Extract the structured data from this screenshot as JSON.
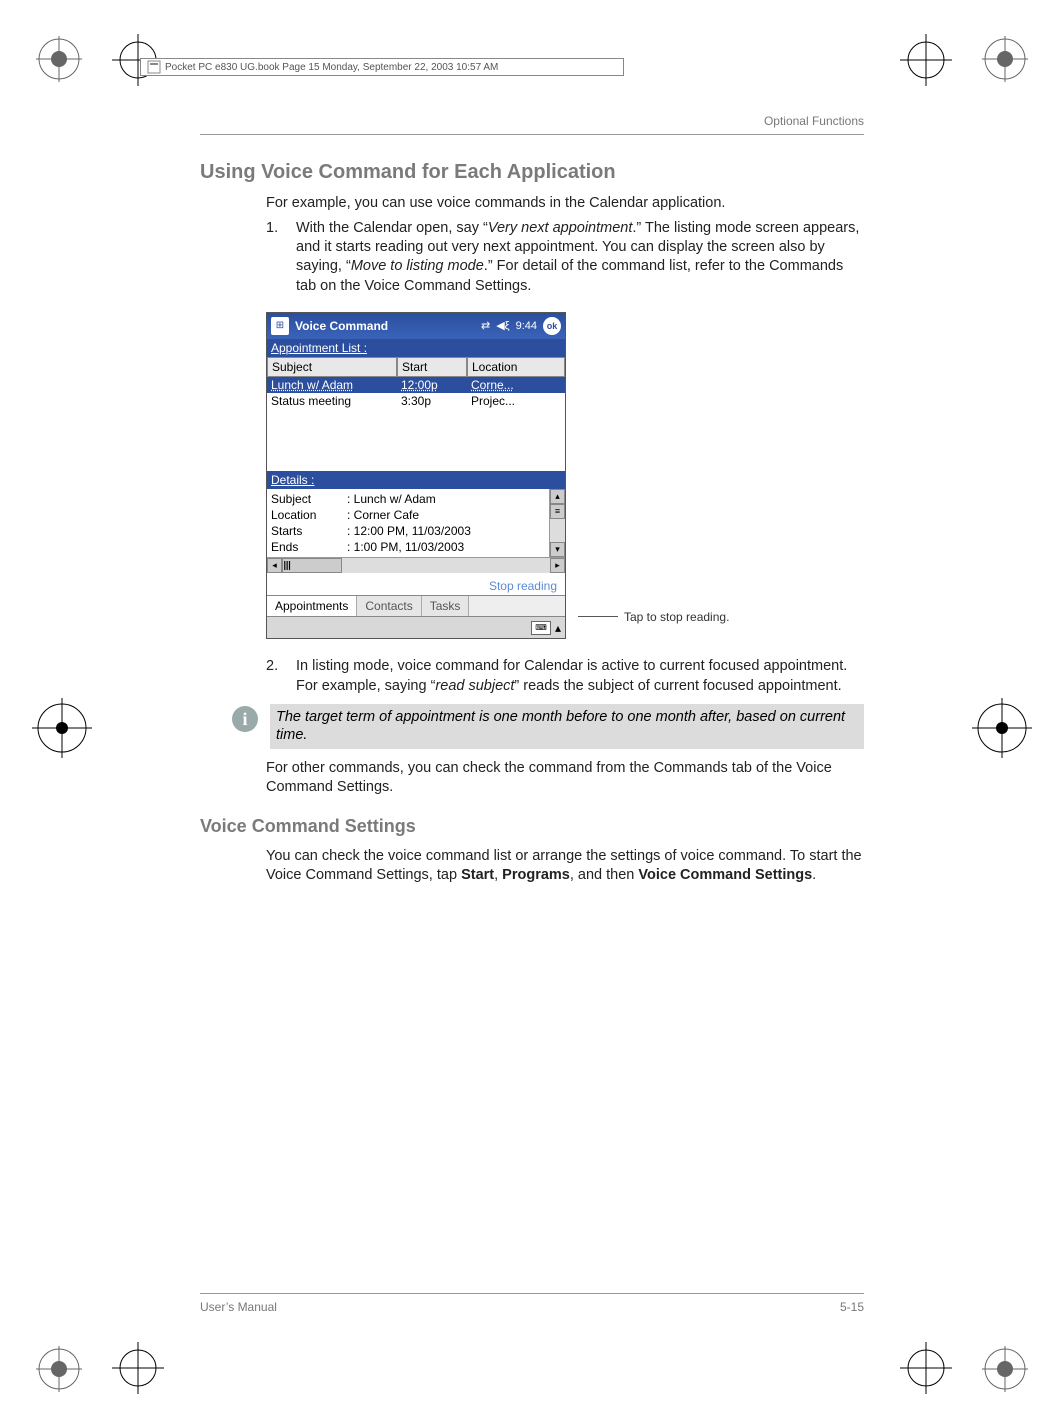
{
  "print": {
    "framemaker_text": "Pocket PC e830 UG.book  Page 15  Monday, September 22, 2003  10:57 AM"
  },
  "header": {
    "running": "Optional Functions"
  },
  "sections": {
    "heading1": "Using Voice Command for Each Application",
    "intro": "For example, you can use voice commands in the Calendar application.",
    "step1_num": "1.",
    "step1_a": "With the Calendar open, say “",
    "step1_b": "Very next appointment",
    "step1_c": ".” The listing mode screen appears, and it starts reading out very next appointment. You can display the screen also by saying, “",
    "step1_d": "Move to listing mode",
    "step1_e": ".” For detail of the command list, refer to the Commands tab on the Voice Command Settings.",
    "callout": "Tap to stop reading.",
    "step2_num": "2.",
    "step2_a": "In listing mode, voice command for Calendar is active to current focused appointment. For example, saying “",
    "step2_b": "read subject",
    "step2_c": "” reads the subject of current focused appointment.",
    "note": "The target term of appointment is one month before to one month after, based on current time.",
    "after_note": "For other commands, you can check the command from the Commands tab of the Voice Command Settings.",
    "heading2": "Voice Command Settings",
    "vcs_a": "You can check the voice command list or arrange the settings of voice command. To start the Voice Command Settings, tap ",
    "vcs_b": "Start",
    "vcs_c": ", ",
    "vcs_d": "Programs",
    "vcs_e": ", and then ",
    "vcs_f": "Voice Command Settings",
    "vcs_g": "."
  },
  "device": {
    "title": "Voice Command",
    "time": "9:44",
    "ok": "ok",
    "appt_list": "Appointment List :",
    "cols": {
      "subject": "Subject",
      "start": "Start",
      "location": "Location"
    },
    "rows": [
      {
        "subject": "Lunch w/ Adam",
        "start": "12:00p",
        "location": "Corne..."
      },
      {
        "subject": "Status meeting",
        "start": "3:30p",
        "location": "Projec..."
      }
    ],
    "details_label": "Details :",
    "details": {
      "k_subject": "Subject",
      "v_subject": ": Lunch w/ Adam",
      "k_location": "Location",
      "v_location": ": Corner Cafe",
      "k_starts": "Starts",
      "v_starts": ": 12:00 PM, 11/03/2003",
      "k_ends": "Ends",
      "v_ends": ": 1:00 PM, 11/03/2003"
    },
    "stop_reading": "Stop reading",
    "tabs": {
      "appointments": "Appointments",
      "contacts": "Contacts",
      "tasks": "Tasks"
    }
  },
  "footer": {
    "left": "User’s Manual",
    "right": "5-15"
  }
}
